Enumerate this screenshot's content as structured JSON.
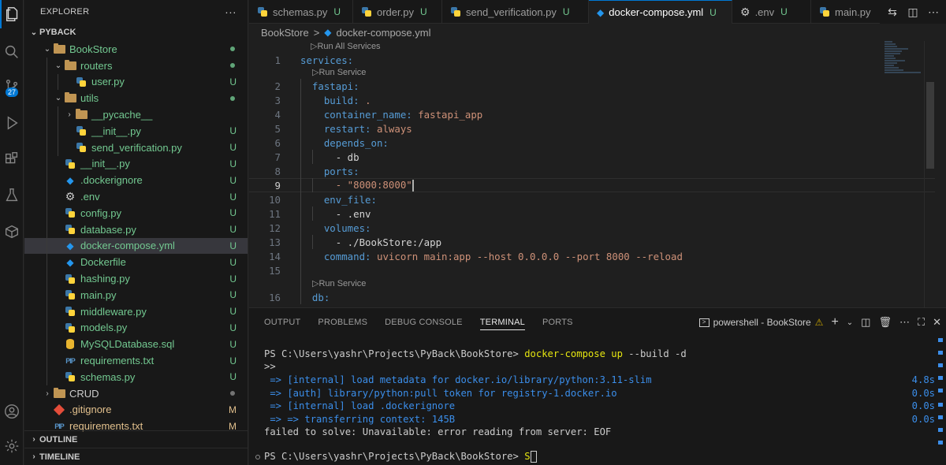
{
  "explorer": {
    "title": "EXPLORER",
    "more_label": "···",
    "root": "PYBACK",
    "rows": [
      {
        "label": "BookStore",
        "kind": "folder",
        "status": "dot"
      },
      {
        "label": "routers",
        "kind": "folder",
        "status": "dot"
      },
      {
        "label": "user.py",
        "kind": "python",
        "status": "U"
      },
      {
        "label": "utils",
        "kind": "folder",
        "status": "dot"
      },
      {
        "label": "__pycache__",
        "kind": "folder",
        "status": ""
      },
      {
        "label": "__init__.py",
        "kind": "python",
        "status": "U"
      },
      {
        "label": "send_verification.py",
        "kind": "python",
        "status": "U"
      },
      {
        "label": "__init__.py",
        "kind": "python",
        "status": "U"
      },
      {
        "label": ".dockerignore",
        "kind": "docker",
        "status": "U"
      },
      {
        "label": ".env",
        "kind": "gear",
        "status": "U"
      },
      {
        "label": "config.py",
        "kind": "python",
        "status": "U"
      },
      {
        "label": "database.py",
        "kind": "python",
        "status": "U"
      },
      {
        "label": "docker-compose.yml",
        "kind": "docker",
        "status": "U"
      },
      {
        "label": "Dockerfile",
        "kind": "docker",
        "status": "U"
      },
      {
        "label": "hashing.py",
        "kind": "python",
        "status": "U"
      },
      {
        "label": "main.py",
        "kind": "python",
        "status": "U"
      },
      {
        "label": "middleware.py",
        "kind": "python",
        "status": "U"
      },
      {
        "label": "models.py",
        "kind": "python",
        "status": "U"
      },
      {
        "label": "MySQLDatabase.sql",
        "kind": "database",
        "status": "U"
      },
      {
        "label": "requirements.txt",
        "kind": "pip",
        "status": "U"
      },
      {
        "label": "schemas.py",
        "kind": "python",
        "status": "U"
      },
      {
        "label": "CRUD",
        "kind": "folder",
        "status": "dot-grey"
      },
      {
        "label": ".gitignore",
        "kind": "git",
        "status": "M"
      },
      {
        "label": "requirements.txt",
        "kind": "pip",
        "status": "M"
      }
    ],
    "outline": "OUTLINE",
    "timeline": "TIMELINE"
  },
  "activity": {
    "source_control_badge": "27",
    "icons": [
      "files-icon",
      "search-icon",
      "source-control-icon",
      "run-debug-icon",
      "extensions-icon",
      "testing-icon",
      "remote-explorer-icon",
      "account-icon",
      "settings-gear-icon"
    ]
  },
  "tabs": [
    {
      "label": "schemas.py",
      "status": "U",
      "icon": "python"
    },
    {
      "label": "order.py",
      "status": "U",
      "icon": "python"
    },
    {
      "label": "send_verification.py",
      "status": "U",
      "icon": "python"
    },
    {
      "label": "docker-compose.yml",
      "status": "U",
      "icon": "docker",
      "active": true
    },
    {
      "label": ".env",
      "status": "U",
      "icon": "gear"
    },
    {
      "label": "main.py",
      "status": "",
      "icon": "python"
    }
  ],
  "breadcrumb": {
    "folder": "BookStore",
    "separator": ">",
    "file": "docker-compose.yml"
  },
  "codelens": {
    "run_all": "Run All Services",
    "run_service": "Run Service"
  },
  "editor_lines": [
    {
      "n": "1",
      "key": "services:",
      "val": ""
    },
    {
      "n": "2",
      "key": "  fastapi:",
      "val": ""
    },
    {
      "n": "3",
      "key": "    build:",
      "val": " ."
    },
    {
      "n": "4",
      "key": "    container_name:",
      "val": " fastapi_app"
    },
    {
      "n": "5",
      "key": "    restart:",
      "val": " always"
    },
    {
      "n": "6",
      "key": "    depends_on:",
      "val": ""
    },
    {
      "n": "7",
      "key": "",
      "val": "      - db"
    },
    {
      "n": "8",
      "key": "    ports:",
      "val": ""
    },
    {
      "n": "9",
      "key": "",
      "val": "      - \"8000:8000\""
    },
    {
      "n": "10",
      "key": "    env_file:",
      "val": ""
    },
    {
      "n": "11",
      "key": "",
      "val": "      - .env"
    },
    {
      "n": "12",
      "key": "    volumes:",
      "val": ""
    },
    {
      "n": "13",
      "key": "",
      "val": "      - ./BookStore:/app"
    },
    {
      "n": "14",
      "key": "    command:",
      "val": " uvicorn main:app --host 0.0.0.0 --port 8000 --reload"
    },
    {
      "n": "15",
      "key": "",
      "val": ""
    },
    {
      "n": "16",
      "key": "  db:",
      "val": ""
    }
  ],
  "panel": {
    "tabs": [
      "OUTPUT",
      "PROBLEMS",
      "DEBUG CONSOLE",
      "TERMINAL",
      "PORTS"
    ],
    "active_tab": "TERMINAL",
    "terminal_name": "powershell - BookStore"
  },
  "terminal": {
    "prompt1": "PS C:\\Users\\yashr\\Projects\\PyBack\\BookStore>",
    "cmd1_main": "docker-compose up",
    "cmd1_args": " --build -d",
    "cont": ">>",
    "steps": [
      {
        "text": " => [internal] load metadata for docker.io/library/python:3.11-slim",
        "time": "4.8s"
      },
      {
        "text": " => [auth] library/python:pull token for registry-1.docker.io",
        "time": "0.0s"
      },
      {
        "text": " => [internal] load .dockerignore",
        "time": "0.0s"
      },
      {
        "text": " => => transferring context: 145B",
        "time": "0.0s"
      }
    ],
    "error": "failed to solve: Unavailable: error reading from server: EOF",
    "prompt2": "PS C:\\Users\\yashr\\Projects\\PyBack\\BookStore>",
    "typed": "S"
  }
}
